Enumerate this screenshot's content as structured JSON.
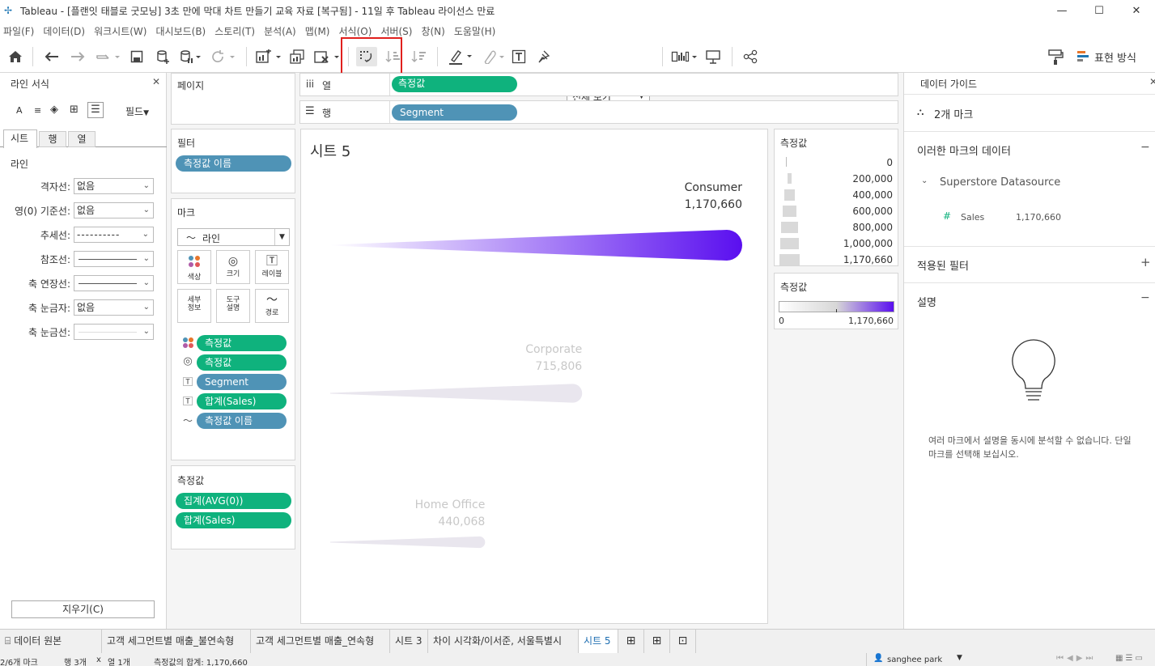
{
  "window": {
    "title": "Tableau - [플랜잇 태블로 굿모닝] 3초 만에 막대 차트 만들기 교육 자료 [복구됨] - 11일 후 Tableau 라이선스 만료",
    "min": "—",
    "max": "☐",
    "close": "✕"
  },
  "menu": [
    "파일(F)",
    "데이터(D)",
    "워크시트(W)",
    "대시보드(B)",
    "스토리(T)",
    "분석(A)",
    "맵(M)",
    "서식(O)",
    "서버(S)",
    "창(N)",
    "도움말(H)"
  ],
  "toolbar": {
    "fit_label": "전체 보기",
    "show_me_label": "표현 방식"
  },
  "format_panel": {
    "title": "라인 서식",
    "tabs_row_label": "필드",
    "tabs": [
      "시트",
      "행",
      "열"
    ],
    "section": "라인",
    "rows": [
      {
        "label": "격자선:",
        "value": "없음"
      },
      {
        "label": "영(0) 기준선:",
        "value": "없음"
      },
      {
        "label": "추세선:",
        "value": "----------"
      },
      {
        "label": "참조선:",
        "value": ""
      },
      {
        "label": "축 연장선:",
        "value": ""
      },
      {
        "label": "축 눈금자:",
        "value": "없음"
      },
      {
        "label": "축 눈금선:",
        "value": ""
      }
    ],
    "clear_button": "지우기(C)"
  },
  "pages": {
    "title": "페이지"
  },
  "filters": {
    "title": "필터",
    "pill": "측정값 이름"
  },
  "marks": {
    "title": "마크",
    "type": "라인",
    "buttons": [
      {
        "label": "색상",
        "icon": "color-icon"
      },
      {
        "label": "크기",
        "icon": "size-icon"
      },
      {
        "label": "레이블",
        "icon": "label-icon"
      },
      {
        "label": "세부\n정보",
        "icon": "detail-icon"
      },
      {
        "label": "도구\n설명",
        "icon": "tooltip-icon"
      },
      {
        "label": "경로",
        "icon": "path-icon"
      }
    ],
    "fields": [
      {
        "icon": "color-icon",
        "label": "측정값",
        "color": "green"
      },
      {
        "icon": "size-icon",
        "label": "측정값",
        "color": "green"
      },
      {
        "icon": "label-icon",
        "label": "Segment",
        "color": "blue"
      },
      {
        "icon": "label-icon",
        "label": "합계(Sales)",
        "color": "green"
      },
      {
        "icon": "path-icon",
        "label": "측정값 이름",
        "color": "blue"
      }
    ]
  },
  "measure_values": {
    "title": "측정값",
    "pills": [
      "집계(AVG(0))",
      "합계(Sales)"
    ]
  },
  "shelves": {
    "columns_label": "열",
    "columns_pill": "측정값",
    "rows_label": "행",
    "rows_pill": "Segment"
  },
  "sheet": {
    "title": "시트 5"
  },
  "chart_data": {
    "type": "bar",
    "categories": [
      "Consumer",
      "Corporate",
      "Home Office"
    ],
    "values": [
      1170660,
      715806,
      440068
    ],
    "value_labels": [
      "1,170,660",
      "715,806",
      "440,068"
    ],
    "highlighted": "Consumer",
    "color_range": [
      "#f2f2f2",
      "#5a0fef"
    ]
  },
  "size_legend": {
    "title": "측정값",
    "items": [
      "0",
      "200,000",
      "400,000",
      "600,000",
      "800,000",
      "1,000,000",
      "1,170,660"
    ]
  },
  "color_legend": {
    "title": "측정값",
    "min": "0",
    "max": "1,170,660"
  },
  "data_guide": {
    "title": "데이터 가이드",
    "marks_count": "2개 마크",
    "section_data": "이러한 마크의 데이터",
    "datasource": "Superstore Datasource",
    "field_name": "Sales",
    "field_value": "1,170,660",
    "section_filters": "적용된 필터",
    "section_desc": "설명",
    "desc_text": "여러 마크에서 설명을 동시에 분석할 수 없습니다. 단일 마크를 선택해 보십시오."
  },
  "sheet_tabs": [
    "데이터 원본",
    "고객 세그먼트별 매출_불연속형",
    "고객 세그먼트별 매출_연속형",
    "시트 3",
    "차이 시각화/이서준, 서울특별시",
    "시트 5"
  ],
  "status": {
    "marks": "2/6개 마크",
    "rows": "행 3개",
    "x": "x",
    "cols": "열 1개",
    "sum": "측정값의 합계: 1,170,660",
    "user": "sanghee park"
  }
}
